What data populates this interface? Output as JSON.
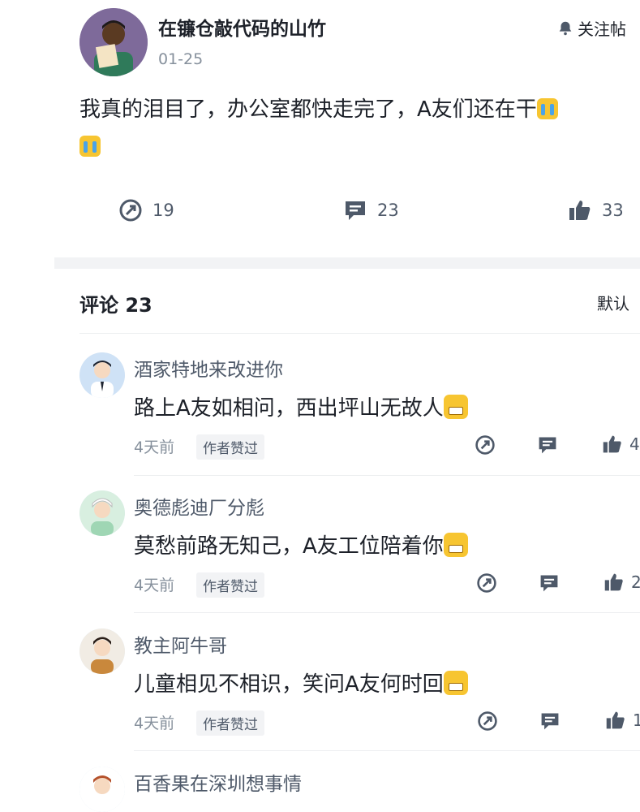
{
  "post": {
    "author": "在镰仓敲代码的山竹",
    "date": "01-25",
    "follow_label": "关注帖",
    "body_line1": "我真的泪目了，办公室都快走完了，A友们还在干",
    "stats": {
      "repost": "19",
      "comments": "23",
      "likes": "33"
    }
  },
  "comments_section": {
    "title": "评论 23",
    "sort_label": "默认"
  },
  "comments": [
    {
      "name": "酒家特地来改进你",
      "text": "路上A友如相问，西出坪山无故人",
      "time": "4天前",
      "badge": "作者赞过",
      "likes": "4"
    },
    {
      "name": "奥德彪迪厂分彪",
      "text": "莫愁前路无知己，A友工位陪着你",
      "time": "4天前",
      "badge": "作者赞过",
      "likes": "2"
    },
    {
      "name": "教主阿牛哥",
      "text": "儿童相见不相识，笑问A友何时回",
      "time": "4天前",
      "badge": "作者赞过",
      "likes": "1"
    },
    {
      "name": "百香果在深圳想事情"
    }
  ],
  "icons": {
    "bell": "bell-icon",
    "repost": "repost-icon",
    "comment": "comment-icon",
    "like": "thumbs-up-icon",
    "emoji_cry": "crying-emoji-icon",
    "emoji_grin": "grinning-emoji-icon"
  }
}
